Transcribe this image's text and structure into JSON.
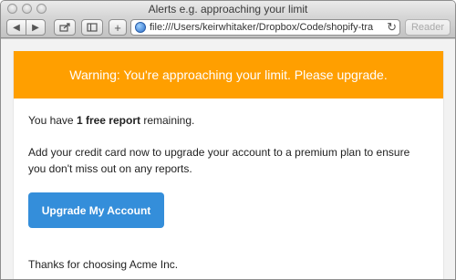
{
  "window": {
    "title": "Alerts e.g. approaching your limit"
  },
  "toolbar": {
    "back_icon": "back-arrow-icon",
    "forward_icon": "forward-arrow-icon",
    "url": "file:///Users/keirwhitaker/Dropbox/Code/shopify-tra",
    "reader_label": "Reader"
  },
  "email": {
    "alert_text": "Warning: You're approaching your limit. Please upgrade.",
    "intro_prefix": "You have ",
    "intro_bold": "1 free report",
    "intro_suffix": " remaining.",
    "paragraph": "Add your credit card now to upgrade your account to a premium plan to ensure you don't miss out on any reports.",
    "button_label": "Upgrade My Account",
    "signoff": "Thanks for choosing Acme Inc."
  },
  "colors": {
    "alert": "#ff9f00",
    "button": "#348eda"
  }
}
